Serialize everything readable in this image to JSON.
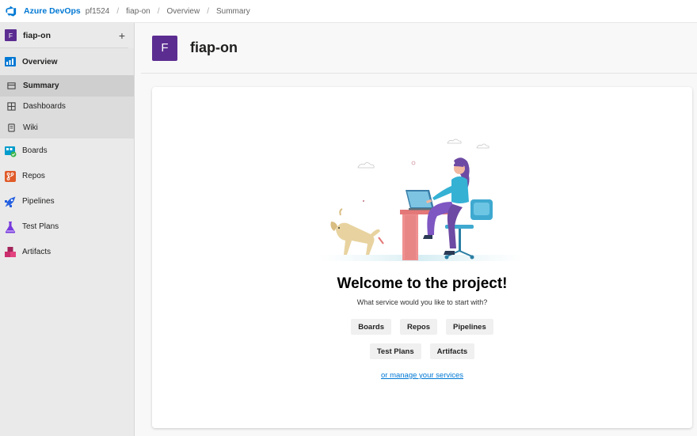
{
  "topbar": {
    "brand": "Azure DevOps",
    "breadcrumbs": [
      "pf1524",
      "fiap-on",
      "Overview",
      "Summary"
    ],
    "separator": "/"
  },
  "sidebar": {
    "project_initial": "F",
    "project_name": "fiap-on",
    "add_label": "+",
    "overview": "Overview",
    "sub_items": [
      {
        "label": "Summary",
        "icon": "summary-icon",
        "active": true
      },
      {
        "label": "Dashboards",
        "icon": "dashboards-icon"
      },
      {
        "label": "Wiki",
        "icon": "wiki-icon"
      }
    ],
    "items": [
      {
        "label": "Boards",
        "icon": "boards-icon",
        "color": "#009ccc"
      },
      {
        "label": "Repos",
        "icon": "repos-icon",
        "color": "#e05b29"
      },
      {
        "label": "Pipelines",
        "icon": "pipelines-icon",
        "color": "#2560e0"
      },
      {
        "label": "Test Plans",
        "icon": "test-plans-icon",
        "color": "#773adc"
      },
      {
        "label": "Artifacts",
        "icon": "artifacts-icon",
        "color": "#cb2e6d"
      }
    ]
  },
  "header": {
    "initial": "F",
    "title": "fiap-on"
  },
  "welcome": {
    "title": "Welcome to the project!",
    "subtitle": "What service would you like to start with?",
    "buttons_row1": [
      "Boards",
      "Repos",
      "Pipelines"
    ],
    "buttons_row2": [
      "Test Plans",
      "Artifacts"
    ],
    "manage_link": "or manage your services"
  },
  "colors": {
    "accent": "#0078d4",
    "project_badge": "#5c2d91"
  }
}
